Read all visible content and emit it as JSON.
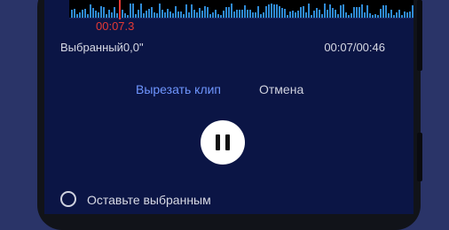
{
  "waveform": {
    "playhead_time": "00:07.3",
    "colors": {
      "wave": "#2f8ad6",
      "playhead": "#e53935",
      "background": "#000000"
    }
  },
  "info": {
    "selected_label": "Выбранный0,0\"",
    "position": "00:07/00:46"
  },
  "actions": {
    "cut_label": "Вырезать клип",
    "cancel_label": "Отмена"
  },
  "playback": {
    "state": "playing",
    "button_icon": "pause-icon"
  },
  "options": {
    "keep_selected_label": "Оставьте выбранным",
    "keep_selected_checked": false
  },
  "colors": {
    "accent": "#6f96ff",
    "screen_bg": "#0b1545",
    "page_bg": "#2a3468"
  }
}
